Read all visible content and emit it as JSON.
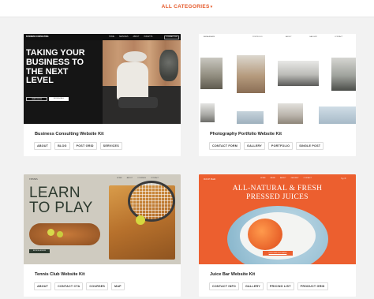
{
  "filter": {
    "label": "ALL CATEGORIES",
    "caret": "▾"
  },
  "cards": [
    {
      "title": "Business Consulting Website Kit",
      "tags": [
        "ABOUT",
        "BLOG",
        "POST GRID",
        "SERVICES"
      ],
      "preview": {
        "logo": "BUSINESS CONSULTING",
        "nav": [
          "HOME",
          "SERVICES",
          "ABOUT",
          "INSIGHTS",
          "CONTACT US"
        ],
        "hero": "TAKING YOUR BUSINESS TO THE NEXT LEVEL",
        "btn1": "LEARN MORE",
        "btn2": "BOOK A CALL"
      }
    },
    {
      "title": "Photography Portfolio Website Kit",
      "tags": [
        "CONTACT FORM",
        "GALLERY",
        "PORTFOLIO",
        "SINGLE POST"
      ],
      "preview": {
        "logo": "ANNA ADAMS",
        "nav": [
          "PORTFOLIO",
          "ABOUT",
          "GALLERY",
          "CONTACT"
        ]
      }
    },
    {
      "title": "Tennis Club Website Kit",
      "tags": [
        "ABOUT",
        "CONTACT CTA",
        "COURSES",
        "MAP"
      ],
      "preview": {
        "logo": "TENNIS",
        "nav": [
          "HOME",
          "ABOUT",
          "COURSES",
          "CONTACT"
        ],
        "hero_line1": "LEARN",
        "hero_line2": "TO PLAY",
        "btn": "BOOK A LESSON"
      }
    },
    {
      "title": "Juice Bar Website Kit",
      "tags": [
        "CONTACT INFO",
        "GALLERY",
        "PRICING LIST",
        "PRODUCT GRID"
      ],
      "preview": {
        "logo": "JUICE BAR",
        "nav": [
          "HOME",
          "MENU",
          "ABOUT",
          "GALLERY",
          "CONTACT"
        ],
        "social": "f ◎ ✆",
        "hero_line1": "ALL-NATURAL & FRESH",
        "hero_line2": "PRESSED JUICES",
        "btn": "DISCOVER OUR MENU"
      }
    }
  ],
  "colors": {
    "accent": "#e55a2b",
    "juice_bg": "#ec5f2f",
    "tennis_bg": "#cfcbc0",
    "business_bg": "#151515"
  }
}
